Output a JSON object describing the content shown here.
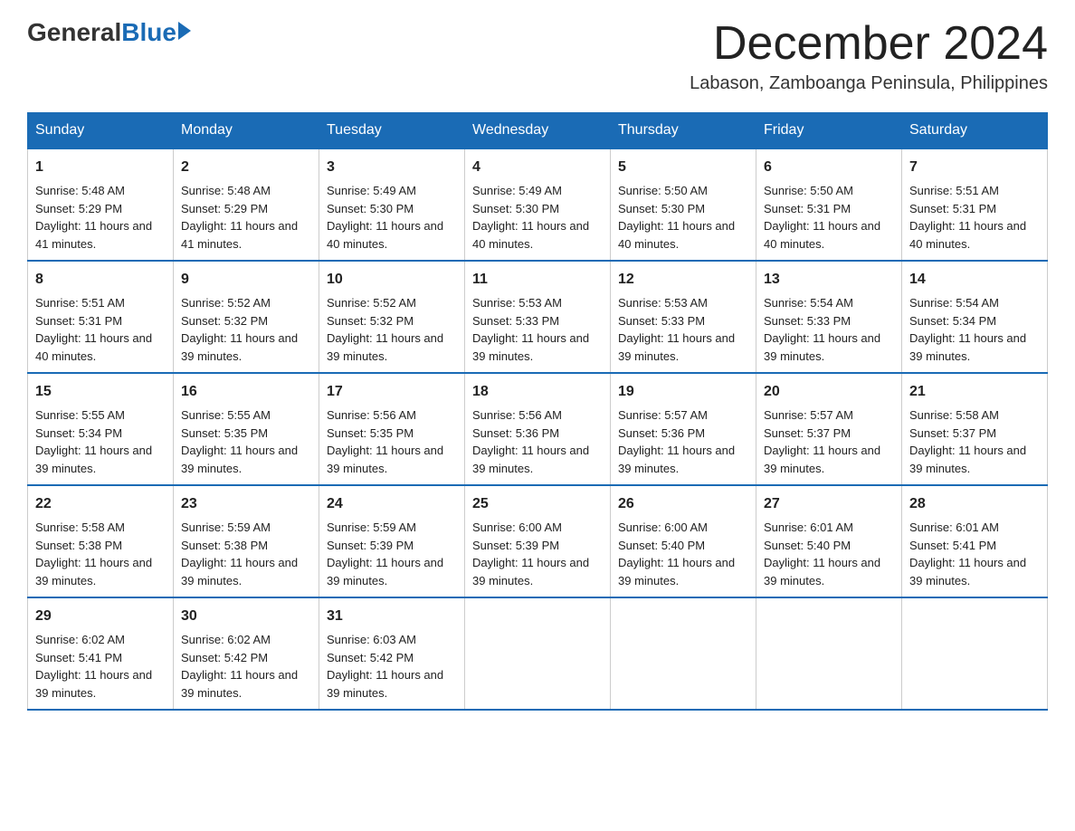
{
  "logo": {
    "general": "General",
    "blue": "Blue"
  },
  "title": "December 2024",
  "location": "Labason, Zamboanga Peninsula, Philippines",
  "headers": [
    "Sunday",
    "Monday",
    "Tuesday",
    "Wednesday",
    "Thursday",
    "Friday",
    "Saturday"
  ],
  "weeks": [
    [
      {
        "day": "1",
        "sunrise": "5:48 AM",
        "sunset": "5:29 PM",
        "daylight": "11 hours and 41 minutes."
      },
      {
        "day": "2",
        "sunrise": "5:48 AM",
        "sunset": "5:29 PM",
        "daylight": "11 hours and 41 minutes."
      },
      {
        "day": "3",
        "sunrise": "5:49 AM",
        "sunset": "5:30 PM",
        "daylight": "11 hours and 40 minutes."
      },
      {
        "day": "4",
        "sunrise": "5:49 AM",
        "sunset": "5:30 PM",
        "daylight": "11 hours and 40 minutes."
      },
      {
        "day": "5",
        "sunrise": "5:50 AM",
        "sunset": "5:30 PM",
        "daylight": "11 hours and 40 minutes."
      },
      {
        "day": "6",
        "sunrise": "5:50 AM",
        "sunset": "5:31 PM",
        "daylight": "11 hours and 40 minutes."
      },
      {
        "day": "7",
        "sunrise": "5:51 AM",
        "sunset": "5:31 PM",
        "daylight": "11 hours and 40 minutes."
      }
    ],
    [
      {
        "day": "8",
        "sunrise": "5:51 AM",
        "sunset": "5:31 PM",
        "daylight": "11 hours and 40 minutes."
      },
      {
        "day": "9",
        "sunrise": "5:52 AM",
        "sunset": "5:32 PM",
        "daylight": "11 hours and 39 minutes."
      },
      {
        "day": "10",
        "sunrise": "5:52 AM",
        "sunset": "5:32 PM",
        "daylight": "11 hours and 39 minutes."
      },
      {
        "day": "11",
        "sunrise": "5:53 AM",
        "sunset": "5:33 PM",
        "daylight": "11 hours and 39 minutes."
      },
      {
        "day": "12",
        "sunrise": "5:53 AM",
        "sunset": "5:33 PM",
        "daylight": "11 hours and 39 minutes."
      },
      {
        "day": "13",
        "sunrise": "5:54 AM",
        "sunset": "5:33 PM",
        "daylight": "11 hours and 39 minutes."
      },
      {
        "day": "14",
        "sunrise": "5:54 AM",
        "sunset": "5:34 PM",
        "daylight": "11 hours and 39 minutes."
      }
    ],
    [
      {
        "day": "15",
        "sunrise": "5:55 AM",
        "sunset": "5:34 PM",
        "daylight": "11 hours and 39 minutes."
      },
      {
        "day": "16",
        "sunrise": "5:55 AM",
        "sunset": "5:35 PM",
        "daylight": "11 hours and 39 minutes."
      },
      {
        "day": "17",
        "sunrise": "5:56 AM",
        "sunset": "5:35 PM",
        "daylight": "11 hours and 39 minutes."
      },
      {
        "day": "18",
        "sunrise": "5:56 AM",
        "sunset": "5:36 PM",
        "daylight": "11 hours and 39 minutes."
      },
      {
        "day": "19",
        "sunrise": "5:57 AM",
        "sunset": "5:36 PM",
        "daylight": "11 hours and 39 minutes."
      },
      {
        "day": "20",
        "sunrise": "5:57 AM",
        "sunset": "5:37 PM",
        "daylight": "11 hours and 39 minutes."
      },
      {
        "day": "21",
        "sunrise": "5:58 AM",
        "sunset": "5:37 PM",
        "daylight": "11 hours and 39 minutes."
      }
    ],
    [
      {
        "day": "22",
        "sunrise": "5:58 AM",
        "sunset": "5:38 PM",
        "daylight": "11 hours and 39 minutes."
      },
      {
        "day": "23",
        "sunrise": "5:59 AM",
        "sunset": "5:38 PM",
        "daylight": "11 hours and 39 minutes."
      },
      {
        "day": "24",
        "sunrise": "5:59 AM",
        "sunset": "5:39 PM",
        "daylight": "11 hours and 39 minutes."
      },
      {
        "day": "25",
        "sunrise": "6:00 AM",
        "sunset": "5:39 PM",
        "daylight": "11 hours and 39 minutes."
      },
      {
        "day": "26",
        "sunrise": "6:00 AM",
        "sunset": "5:40 PM",
        "daylight": "11 hours and 39 minutes."
      },
      {
        "day": "27",
        "sunrise": "6:01 AM",
        "sunset": "5:40 PM",
        "daylight": "11 hours and 39 minutes."
      },
      {
        "day": "28",
        "sunrise": "6:01 AM",
        "sunset": "5:41 PM",
        "daylight": "11 hours and 39 minutes."
      }
    ],
    [
      {
        "day": "29",
        "sunrise": "6:02 AM",
        "sunset": "5:41 PM",
        "daylight": "11 hours and 39 minutes."
      },
      {
        "day": "30",
        "sunrise": "6:02 AM",
        "sunset": "5:42 PM",
        "daylight": "11 hours and 39 minutes."
      },
      {
        "day": "31",
        "sunrise": "6:03 AM",
        "sunset": "5:42 PM",
        "daylight": "11 hours and 39 minutes."
      },
      null,
      null,
      null,
      null
    ]
  ]
}
